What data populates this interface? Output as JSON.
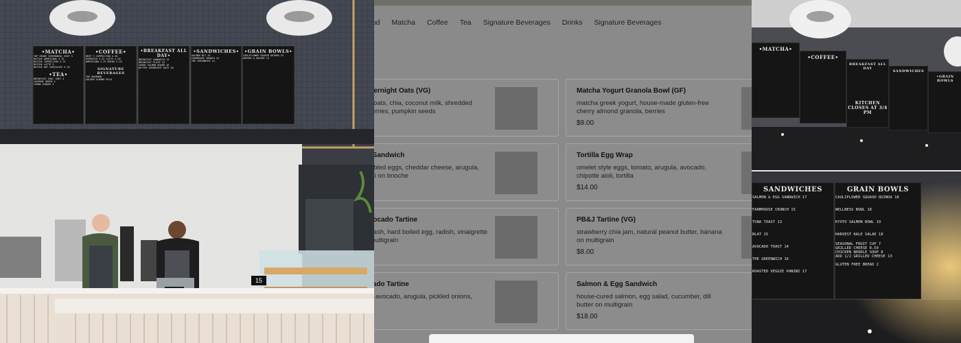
{
  "menu_panel": {
    "tabs": [
      "ood",
      "Matcha",
      "Coffee",
      "Tea",
      "Signature Beverages",
      "Drinks",
      "Signature Beverages"
    ],
    "items_left": [
      {
        "name": "Overnight Oats (VG)",
        "desc": "ed oats, chia, coconut milk, shredded\n, berries, pumpkin seeds",
        "price": ""
      },
      {
        "name": "st Sandwich",
        "desc": "umbled eggs, cheddar cheese, arugula,\naioli on brioche",
        "price": ""
      },
      {
        "name": "Avocado Tartine",
        "desc": "smash, hard boiled egg, radish, vinaigrette\nn multigrain",
        "price": ""
      },
      {
        "name": "ocado Tartine",
        "desc": "ad, avocado, arugula, pickled onions,\nn",
        "price": ""
      }
    ],
    "items_right": [
      {
        "name": "Matcha Yogurt Granola Bowl (GF)",
        "desc": "matcha greek yogurt, house-made gluten-free cherry almond granola, berries",
        "price": "$9.00"
      },
      {
        "name": "Tortilla Egg Wrap",
        "desc": "omelet style eggs, tomato, arugula, avocado, chipotle aioli, tortilla",
        "price": "$14.00"
      },
      {
        "name": "PB&J Tartine (VG)",
        "desc": "strawberry chia jam, natural peanut butter, banana on multigrain",
        "price": "$8.00"
      },
      {
        "name": "Salmon & Egg Sandwich",
        "desc": "house-cured salmon, egg salad, cucumber, dill butter on multigrain",
        "price": "$18.00"
      }
    ]
  },
  "photo_left": {
    "boards": [
      {
        "title": "•MATCHA•",
        "lines": [
          "FINELY GROUND GREEN TEA POWDER",
          "TOP GRADE CEREMONIAL SHOT 5",
          "MATCHA AMERICANO 4.75",
          "MATCHA CAPPUCCINO 4.75",
          "MATCHA LATTE 5",
          "MATCHA HOT CHOCOLATE 5.25",
          "MATCHA ICED TEA 5",
          "ICED MATCHA LATTE 5.75"
        ],
        "subtitle": "•TEA•",
        "sublines": [
          "BREAKFAST EARL GREY 4",
          "JASMINE GREEN 4",
          "LEMON GINGER 4",
          "OOLONG 4",
          "MINT 4",
          "SEASONAL ICED TEA 4"
        ]
      },
      {
        "title": "•COFFEE•",
        "lines": [
          "DRIP 3 CAPPUCCINO 4.50",
          "ESPRESSO 3.25 LATTE 4.50",
          "AMERICANO 3.25 MOCHA 5.25",
          "MACCHIATO 3.50 ICED COFFEE 4",
          "CORTADO 4 HOT CHOCOLATE 4.25"
        ],
        "subtitle": "SIGNATURE BEVERAGES",
        "sublines": [
          "THE BOURBON",
          "GOLDEN ALMOND MILK",
          "MATCHA HOT CHOCOLATE",
          "ESPRESSO TONIC"
        ]
      },
      {
        "title": "•BREAKFAST ALL DAY•",
        "lines": [
          "BREAKFAST SANDWICH 13",
          "BREAKFAST PLATE 15",
          "CURED SALMON BOARD 16",
          "BETTER OVERNIGHT OATS 10",
          "GOLDEN GRANOLA BOWL 12"
        ],
        "subtitle": "",
        "sublines": []
      },
      {
        "title": "•SANDWICHES•",
        "lines": [
          "SALMON BLT 15",
          "FARMHOUSE CRUNCH 14",
          "THE GREENWICH 14",
          "WESTSIDE WALDORF 15",
          "CHILLI CLUB 15"
        ],
        "subtitle": "",
        "sublines": []
      },
      {
        "title": "•GRAIN BOWLS•",
        "lines": [
          "CAULIFLOWER SQUASH QUINOA 15",
          "GREENS & GRAINS 13"
        ],
        "subtitle": "",
        "sublines": []
      }
    ],
    "price_card": "15"
  },
  "photo_right_top": {
    "boards": [
      "•MATCHA•",
      "•COFFEE•",
      "BREAKFAST ALL DAY",
      "SANDWICHES",
      "•GRAIN BOWLS"
    ],
    "notice": "KITCHEN CLOSES AT 3/4 PM"
  },
  "photo_right_bottom": {
    "boards": [
      {
        "title": "SANDWICHES",
        "lines": [
          "SALMON & EGG SANDWICH 17",
          "FARMHOUSE CRUNCH 15",
          "TUNA TOAST 13",
          "BLAT 15",
          "AVOCADO TOAST 14",
          "THE GREENWICH 16",
          "ROASTED VEGGIE PANINI 17"
        ]
      },
      {
        "title": "GRAIN BOWLS",
        "lines": [
          "CAULIFLOWER SQUASH QUINOA 18",
          "WELLNESS BOWL 18",
          "KYOTO SALMON BOWL 19",
          "HARVEST KALE SALAD 18",
          "SEASONAL FRUIT CUP 7",
          "GRILLED CHEESE 8.50",
          "CHICKEN NOODLE SOUP 8",
          "ADD 1/2 GRILLED CHEESE 13"
        ]
      }
    ],
    "footer": "GLUTEN FREE   BREAD   2"
  },
  "colors": {
    "overlay": "#8a8a8a",
    "card_border": "#a6a6a6",
    "thumb": "#6b6b6b",
    "sheet": "#f3f3f3"
  }
}
